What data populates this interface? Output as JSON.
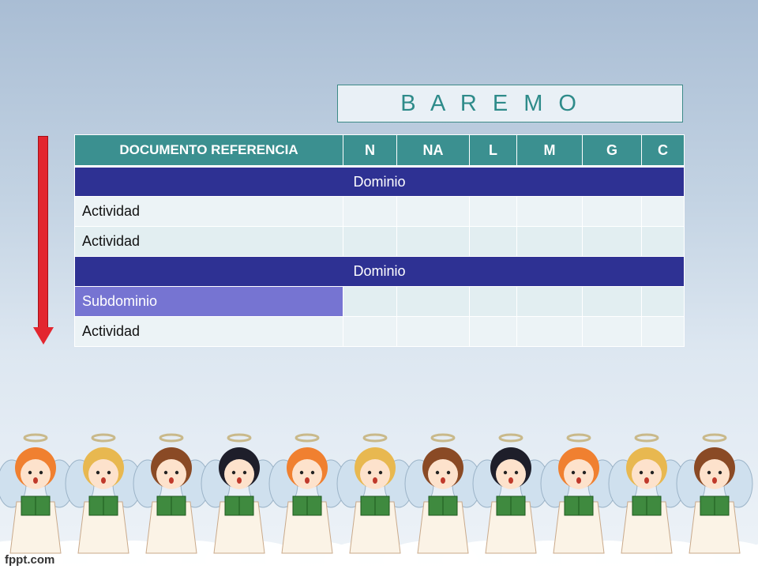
{
  "title": "B A R E M O",
  "table": {
    "headers": [
      "DOCUMENTO REFERENCIA",
      "N",
      "NA",
      "L",
      "M",
      "G",
      "C"
    ],
    "rows": [
      {
        "type": "domain",
        "label": "Dominio"
      },
      {
        "type": "activity",
        "label": "Actividad"
      },
      {
        "type": "activity",
        "label": "Actividad"
      },
      {
        "type": "domain",
        "label": "Dominio"
      },
      {
        "type": "subdomain",
        "label": "Subdominio"
      },
      {
        "type": "activity",
        "label": "Actividad"
      }
    ]
  },
  "watermark": "fppt.com",
  "colors": {
    "header": "#3b9090",
    "domain_row": "#2e3193",
    "subdomain_cell": "#7674d2",
    "arrow": "#e3262f",
    "title_text": "#2e8b8a"
  },
  "icons": [
    "down-arrow-icon",
    "angel-choir-illustration"
  ]
}
